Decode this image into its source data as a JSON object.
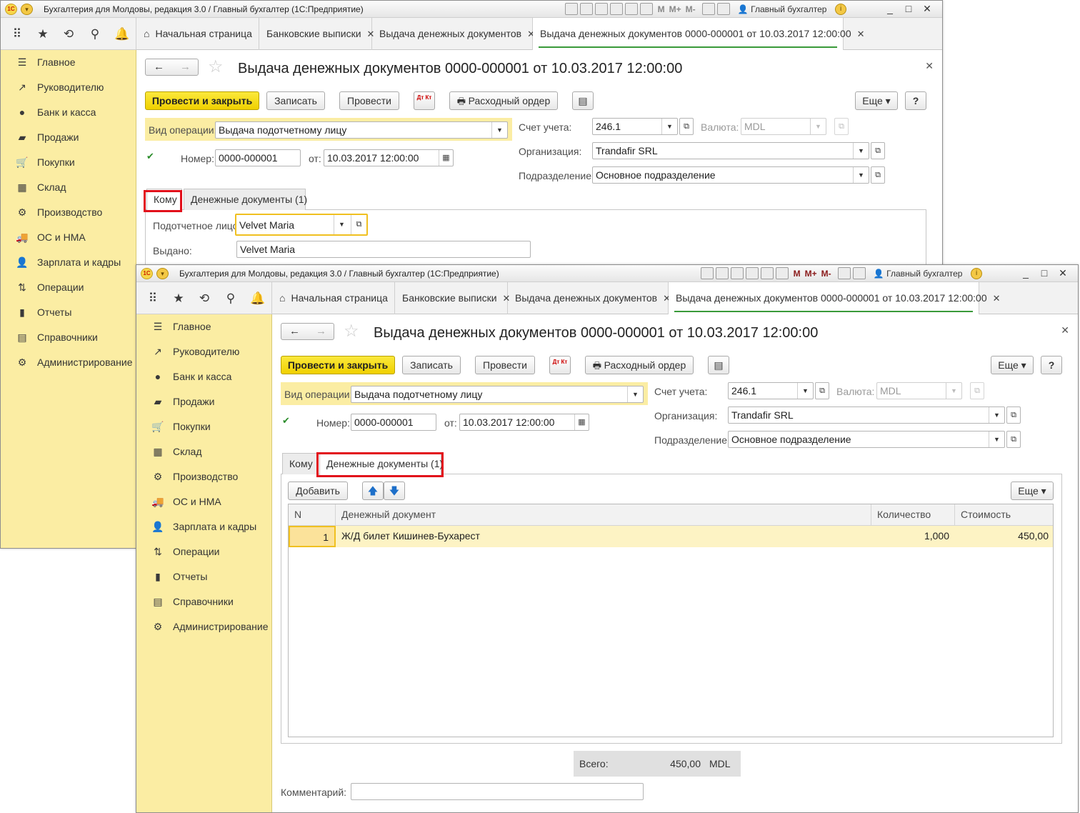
{
  "app_title": "Бухгалтерия для Молдовы, редакция 3.0 / Главный бухгалтер  (1С:Предприятие)",
  "user": "Главный бухгалтер",
  "toolbar_letters": [
    "M",
    "M+",
    "M-"
  ],
  "window_controls": [
    "_",
    "□",
    "✕"
  ],
  "icons": {
    "apps": "grid-icon",
    "favorites": "star-icon",
    "history": "history-icon",
    "search": "search-icon",
    "notifications": "bell-icon"
  },
  "tabs": [
    {
      "label": "Начальная страница",
      "closable": false
    },
    {
      "label": "Банковские выписки",
      "closable": true
    },
    {
      "label": "Выдача денежных документов",
      "closable": true
    },
    {
      "label": "Выдача денежных документов 0000-000001 от 10.03.2017 12:00:00",
      "closable": true,
      "active": true
    }
  ],
  "sidebar": {
    "items": [
      {
        "label": "Главное",
        "icon": "menu-icon"
      },
      {
        "label": "Руководителю",
        "icon": "trend-icon"
      },
      {
        "label": "Банк и касса",
        "icon": "coin-icon"
      },
      {
        "label": "Продажи",
        "icon": "bag-icon"
      },
      {
        "label": "Покупки",
        "icon": "cart-icon"
      },
      {
        "label": "Склад",
        "icon": "warehouse-icon"
      },
      {
        "label": "Производство",
        "icon": "factory-icon"
      },
      {
        "label": "ОС и НМА",
        "icon": "truck-icon"
      },
      {
        "label": "Зарплата и кадры",
        "icon": "person-icon"
      },
      {
        "label": "Операции",
        "icon": "dt-kt-icon"
      },
      {
        "label": "Отчеты",
        "icon": "chart-icon"
      },
      {
        "label": "Справочники",
        "icon": "book-icon"
      },
      {
        "label": "Администрирование",
        "icon": "gear-icon"
      }
    ]
  },
  "form": {
    "title": "Выдача денежных документов 0000-000001 от 10.03.2017 12:00:00",
    "buttons": {
      "post_close": "Провести и закрыть",
      "save": "Записать",
      "post": "Провести",
      "dtkt": "Дт Кт",
      "order": "Расходный ордер",
      "more": "Еще",
      "help": "?"
    },
    "operation_label": "Вид операции:",
    "operation_value": "Выдача подотчетному лицу",
    "number_label": "Номер:",
    "number_value": "0000-000001",
    "date_label": "от:",
    "date_value": "10.03.2017 12:00:00",
    "account_label": "Счет учета:",
    "account_value": "246.1",
    "currency_label": "Валюта:",
    "currency_value": "MDL",
    "org_label": "Организация:",
    "org_value": "Trandafir SRL",
    "dept_label": "Подразделение:",
    "dept_value": "Основное подразделение",
    "tab_to": "Кому",
    "tab_docs": "Денежные документы (1)",
    "person_label": "Подотчетное лицо:",
    "person_value": "Velvet Maria",
    "issued_label": "Выдано:",
    "issued_value": "Velvet Maria",
    "add_button": "Добавить",
    "up_label": "🡅",
    "down_label": "🡇",
    "table": {
      "headers": [
        "N",
        "Денежный документ",
        "Количество",
        "Стоимость"
      ],
      "rows": [
        {
          "n": "1",
          "doc": "Ж/Д билет Кишинев-Бухарест",
          "qty": "1,000",
          "cost": "450,00"
        }
      ]
    },
    "total_label": "Всего:",
    "total_value": "450,00",
    "total_currency": "MDL",
    "comment_label": "Комментарий:",
    "comment_value": ""
  },
  "colors": {
    "accent_yellow": "#f5d800",
    "sidebar": "#fbeda3",
    "highlight_red": "#e2101b",
    "active_underline": "#3a9a3a"
  }
}
